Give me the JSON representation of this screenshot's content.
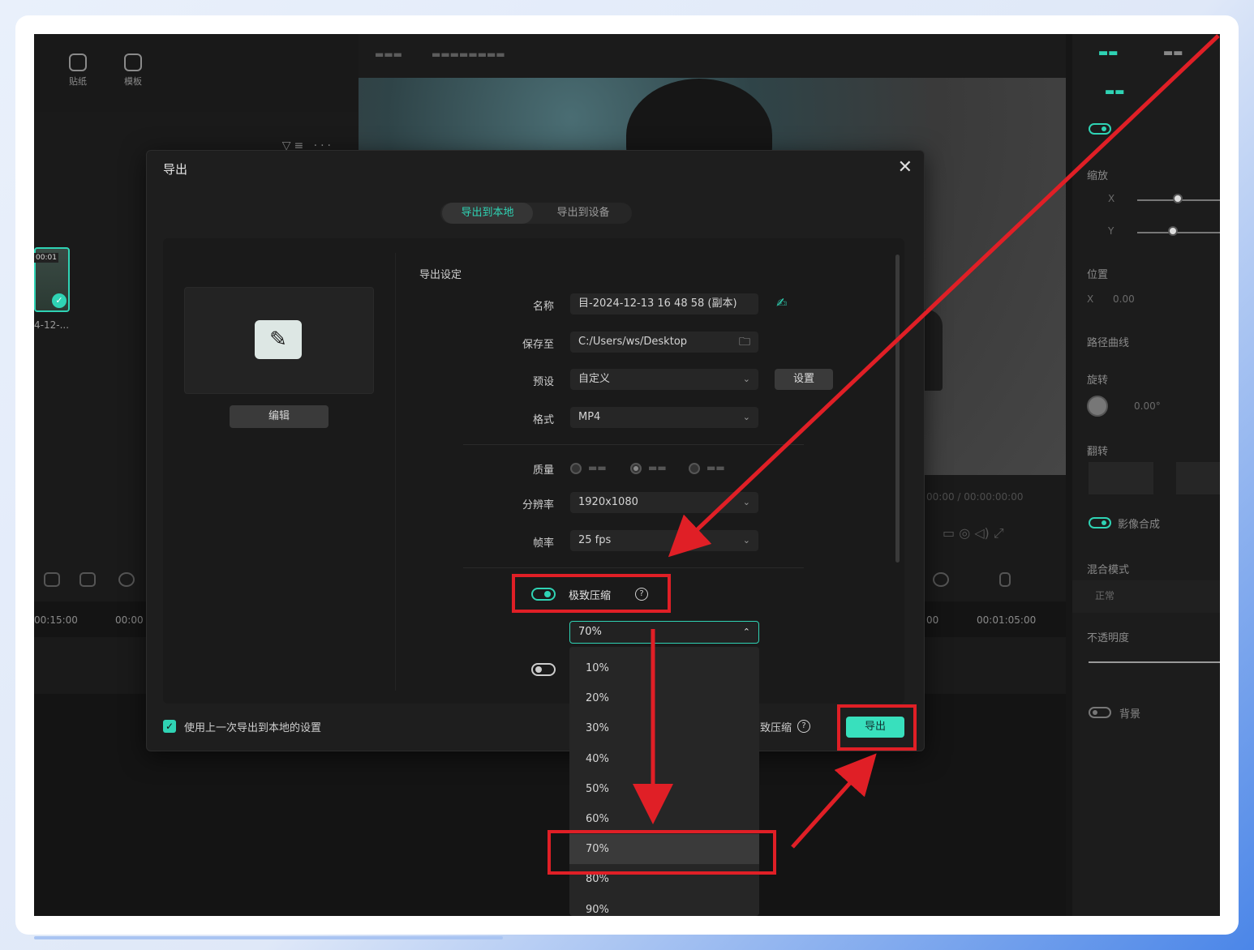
{
  "toolbar": {
    "sticker_label": "贴纸",
    "template_label": "模板"
  },
  "media": {
    "thumb_time": "00:01",
    "thumb_label": "4-12-..."
  },
  "dialog": {
    "title": "导出",
    "close_glyph": "✕",
    "tabs": [
      {
        "label": "导出到本地",
        "active": true
      },
      {
        "label": "导出到设备",
        "active": false
      }
    ],
    "edit_button": "编辑",
    "section_title": "导出设定",
    "fields": {
      "name_label": "名称",
      "name_value": "目-2024-12-13 16 48 58 (副本)",
      "saveto_label": "保存至",
      "saveto_value": "C:/Users/ws/Desktop",
      "preset_label": "预设",
      "preset_value": "自定义",
      "preset_button": "设置",
      "format_label": "格式",
      "format_value": "MP4",
      "quality_label": "质量",
      "resolution_label": "分辨率",
      "resolution_value": "1920x1080",
      "framerate_label": "帧率",
      "framerate_value": "25 fps",
      "compress_label": "极致压缩",
      "compress_value": "70%"
    },
    "footer": {
      "checkbox_label": "使用上一次导出到本地的设置",
      "compress_hint": "致压缩",
      "export_button": "导出"
    },
    "compress_options": [
      "10%",
      "20%",
      "30%",
      "40%",
      "50%",
      "60%",
      "70%",
      "80%",
      "90%"
    ],
    "selected_option": "70%"
  },
  "timeline": {
    "ruler_left": "00:15:00",
    "ruler_left2": "00:00",
    "ruler_right1": "00",
    "ruler_right2": "00:01:05:00"
  },
  "inspector": {
    "labels": [
      "缩放",
      "位置",
      "路径曲线",
      "旋转",
      "翻转",
      "影像合成",
      "混合模式",
      "不透明度",
      "背景"
    ],
    "position_x_value": "0.00",
    "rotation_value": "0.00°",
    "blend_mode_value": "正常"
  },
  "colors": {
    "accent": "#2fd3b4",
    "export_button": "#38e0bd",
    "annotation_red": "#e01f26"
  }
}
